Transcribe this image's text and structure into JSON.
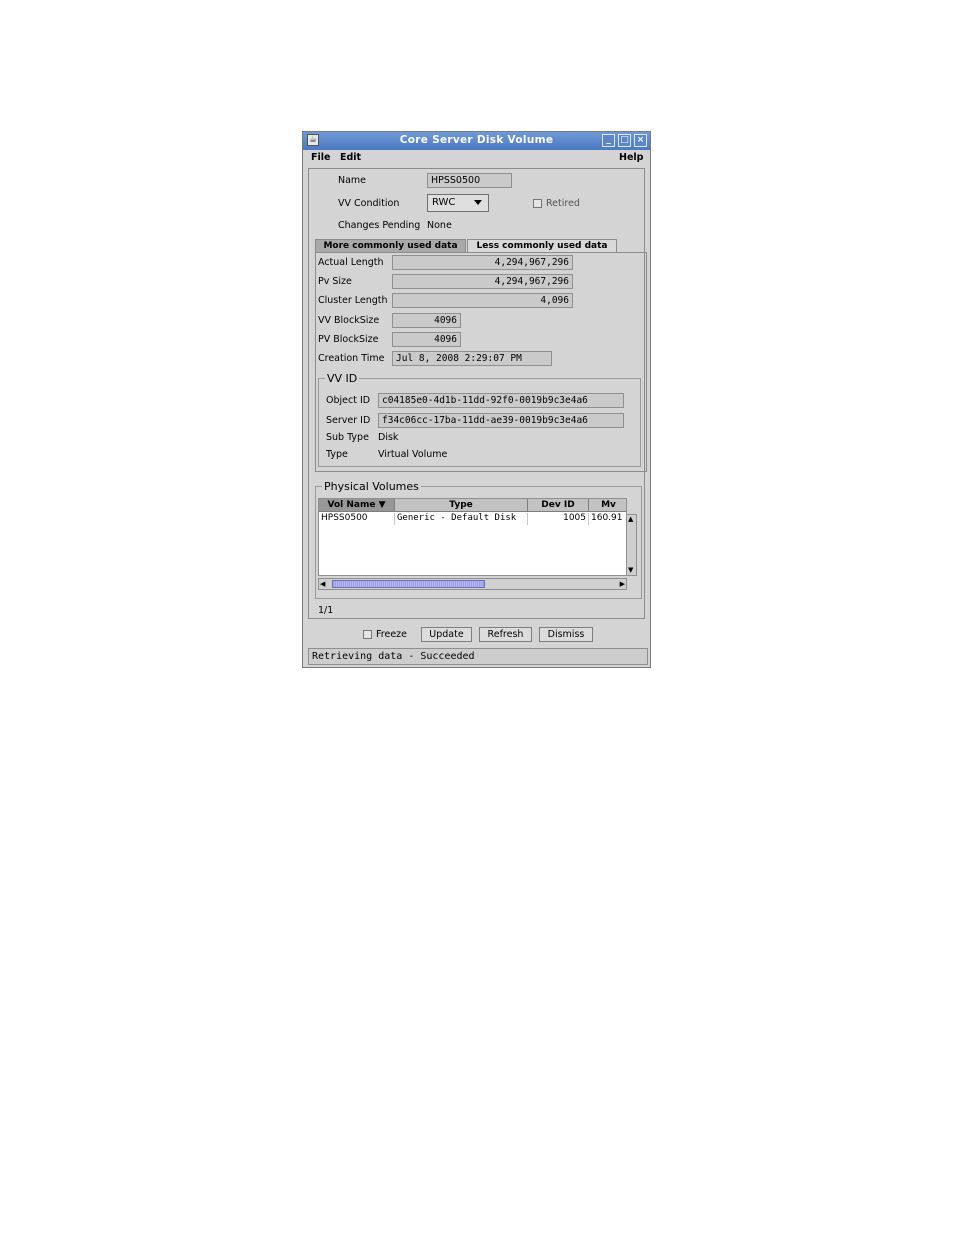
{
  "window": {
    "title": "Core Server Disk Volume",
    "app_icon": "java-cup-icon",
    "controls": [
      "minimize-icon",
      "maximize-icon",
      "close-icon"
    ]
  },
  "menubar": {
    "file": "File",
    "edit": "Edit",
    "help": "Help"
  },
  "header": {
    "name_label": "Name",
    "name_value": "HPSS0500",
    "condition_label": "VV Condition",
    "condition_value": "RWC",
    "retired_label": "Retired",
    "retired_checked": false,
    "pending_label": "Changes Pending",
    "pending_value": "None"
  },
  "tabs": [
    {
      "label": "More commonly used data",
      "active": true
    },
    {
      "label": "Less commonly used data",
      "active": false
    }
  ],
  "details": {
    "actual_length_label": "Actual Length",
    "actual_length": "4,294,967,296",
    "pv_size_label": "Pv Size",
    "pv_size": "4,294,967,296",
    "cluster_length_label": "Cluster Length",
    "cluster_length": "4,096",
    "vv_blocksize_label": "VV BlockSize",
    "vv_blocksize": "4096",
    "pv_blocksize_label": "PV BlockSize",
    "pv_blocksize": "4096",
    "creation_time_label": "Creation Time",
    "creation_time": "Jul 8, 2008 2:29:07 PM"
  },
  "vvid": {
    "title": "VV ID",
    "object_id_label": "Object ID",
    "object_id": "c04185e0-4d1b-11dd-92f0-0019b9c3e4a6",
    "server_id_label": "Server ID",
    "server_id": "f34c06cc-17ba-11dd-ae39-0019b9c3e4a6",
    "subtype_label": "Sub Type",
    "subtype": "Disk",
    "type_label": "Type",
    "type": "Virtual Volume"
  },
  "physical_volumes": {
    "title": "Physical Volumes",
    "columns": [
      "Vol Name ▼",
      "Type",
      "Dev ID",
      "Mv"
    ],
    "rows": [
      [
        "HPSS0500",
        "Generic - Default Disk",
        "1005",
        "160.91"
      ]
    ],
    "page_count": "1/1"
  },
  "footer": {
    "freeze_label": "Freeze",
    "freeze_checked": false,
    "update": "Update",
    "refresh": "Refresh",
    "dismiss": "Dismiss"
  },
  "status": "Retrieving data - Succeeded"
}
